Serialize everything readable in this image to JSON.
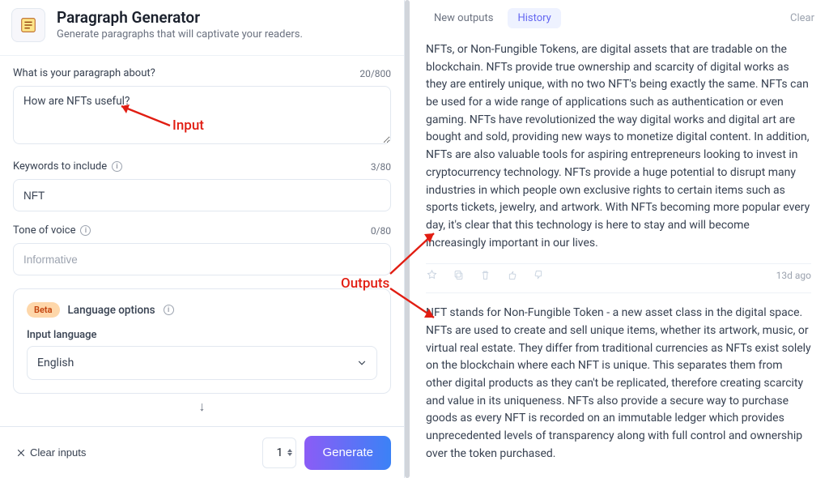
{
  "header": {
    "title": "Paragraph Generator",
    "subtitle": "Generate paragraphs that will captivate your readers."
  },
  "form": {
    "topic": {
      "label": "What is your paragraph about?",
      "value": "How are NFTs useful?",
      "counter": "20/800"
    },
    "keywords": {
      "label": "Keywords to include",
      "value": "NFT",
      "counter": "3/80"
    },
    "tone": {
      "label": "Tone of voice",
      "placeholder": "Informative",
      "counter": "0/80"
    },
    "language": {
      "badge": "Beta",
      "title": "Language options",
      "input_label": "Input language",
      "selected": "English"
    }
  },
  "footer": {
    "clear_label": "Clear inputs",
    "quantity": "1",
    "generate": "Generate"
  },
  "right": {
    "tabs": {
      "new": "New outputs",
      "history": "History"
    },
    "clear": "Clear",
    "outputs": [
      "NFTs, or Non-Fungible Tokens, are digital assets that are tradable on the blockchain. NFTs provide true ownership and scarcity of digital works as they are entirely unique, with no two NFT's being exactly the same. NFTs can be used for a wide range of applications such as authentication or even gaming. NFTs have revolutionized the way digital works and digital art are bought and sold, providing new ways to monetize digital content. In addition, NFTs are also valuable tools for aspiring entrepreneurs looking to invest in cryptocurrency technology. NFTs provide a huge potential to disrupt many industries in which people own exclusive rights to certain items such as sports tickets, jewelry, and artwork. With NFTs becoming more popular every day, it's clear that this technology is here to stay and will become increasingly important in our lives.",
      "NFT stands for Non-Fungible Token - a new asset class in the digital space. NFTs are used to create and sell unique items, whether its artwork, music, or virtual real estate. They differ from traditional currencies as NFTs exist solely on the blockchain where each NFT is unique. This separates them from other digital products as they can't be replicated, therefore creating scarcity and value in its uniqueness. NFTs also provide a secure way to purchase goods as every NFT is recorded on an immutable ledger which provides unprecedented levels of transparency along with full control and ownership over the token purchased."
    ],
    "meta_time": "13d ago"
  },
  "annotations": {
    "input_label": "Input",
    "outputs_label": "Outputs"
  }
}
